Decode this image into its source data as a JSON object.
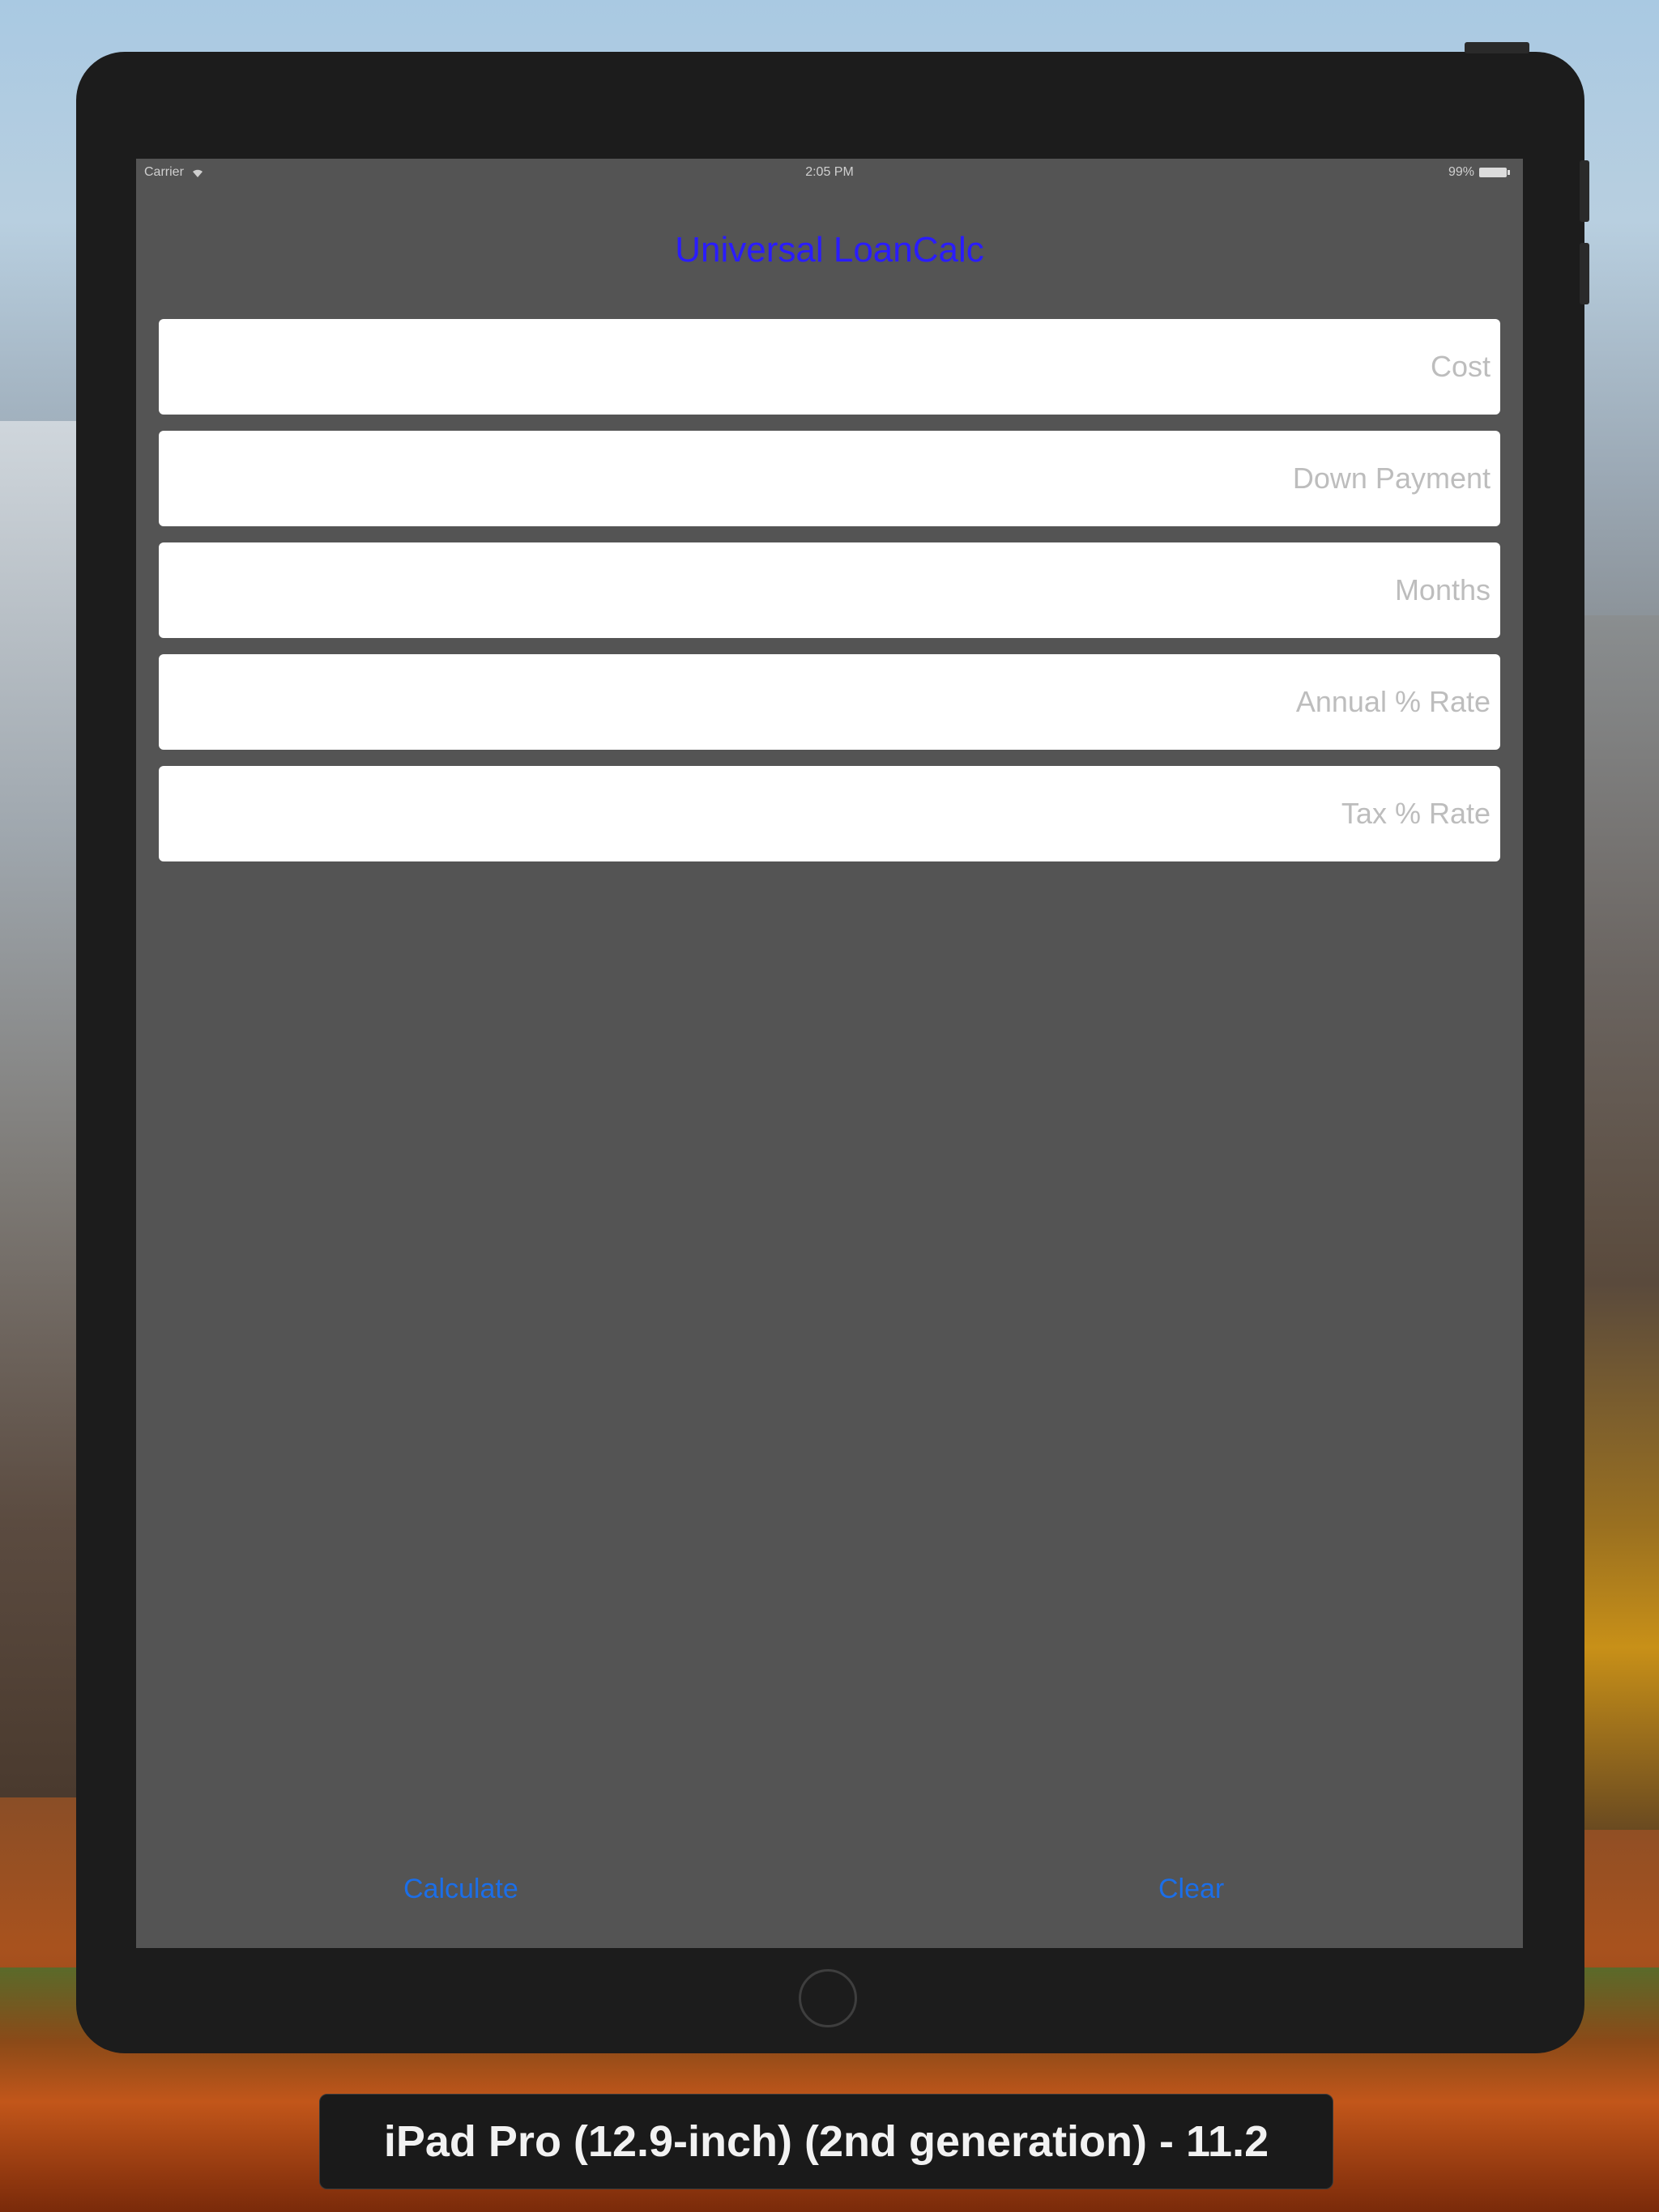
{
  "statusbar": {
    "carrier": "Carrier",
    "time": "2:05 PM",
    "battery": "99%"
  },
  "app": {
    "title": "Universal LoanCalc"
  },
  "fields": [
    {
      "placeholder": "Cost",
      "value": ""
    },
    {
      "placeholder": "Down Payment",
      "value": ""
    },
    {
      "placeholder": "Months",
      "value": ""
    },
    {
      "placeholder": "Annual % Rate",
      "value": ""
    },
    {
      "placeholder": "Tax % Rate",
      "value": ""
    }
  ],
  "buttons": {
    "calculate": "Calculate",
    "clear": "Clear"
  },
  "simulator": {
    "device_label": "iPad Pro (12.9-inch) (2nd generation) - 11.2"
  },
  "colors": {
    "title": "#2a1cff",
    "button": "#1b6ee8",
    "screen_bg": "#545454",
    "device_bezel": "#1c1c1c"
  },
  "icons": [
    "wifi-icon",
    "battery-icon",
    "home-button"
  ]
}
